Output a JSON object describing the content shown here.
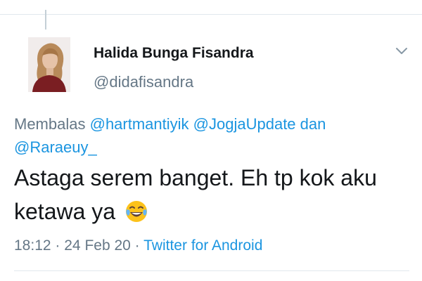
{
  "author": {
    "display_name": "Halida Bunga Fisandra",
    "handle": "@didafisandra",
    "avatar_icon": "profile-photo"
  },
  "reply": {
    "prefix": "Membalas",
    "mention_1": "@hartmantiyik",
    "mention_2": "@JogjaUpdate",
    "conjunction": "dan",
    "mention_3": "@Raraeuy_"
  },
  "tweet": {
    "text": "Astaga serem banget. Eh tp kok aku ketawa ya",
    "emoji_icon": "face-with-tears-of-joy-icon"
  },
  "meta": {
    "time": "18:12",
    "date": "24 Feb 20",
    "separator": "·",
    "source": "Twitter for Android"
  },
  "menu": {
    "icon": "chevron-down-icon"
  },
  "colors": {
    "link": "#1b95e0",
    "secondary_text": "#657786",
    "primary_text": "#14171a",
    "divider": "#e1e8ed"
  }
}
